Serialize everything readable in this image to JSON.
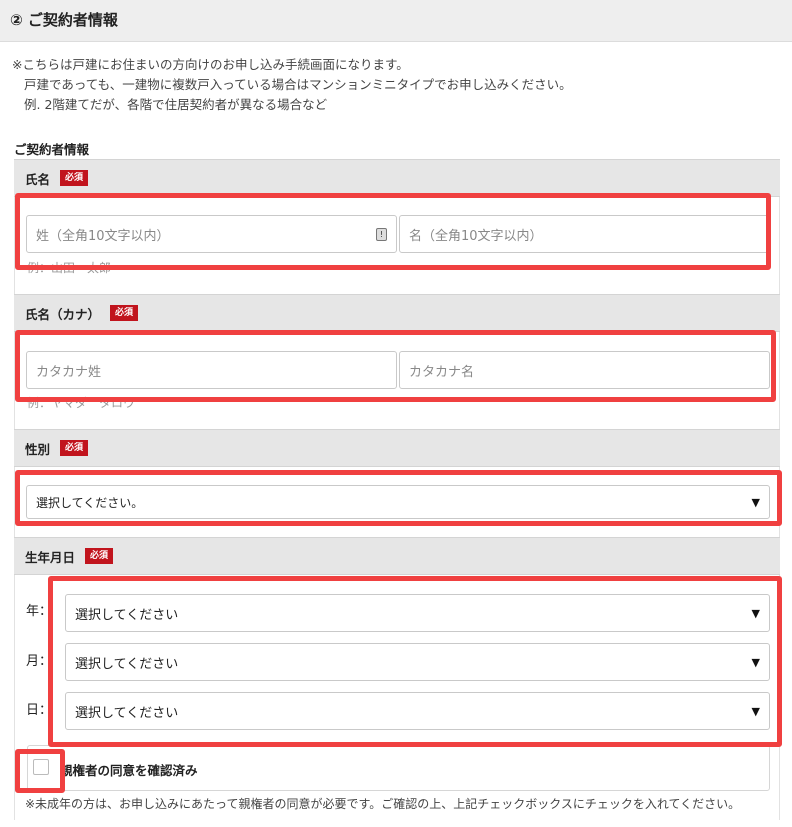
{
  "section": {
    "title": "② ご契約者情報"
  },
  "notice": {
    "line1": "※こちらは戸建にお住まいの方向けのお申し込み手続画面になります。",
    "line2": "戸建であっても、一建物に複数戸入っている場合はマンションミニタイプでお申し込みください。",
    "line3": "例. 2階建てだが、各階で住居契約者が異なる場合など"
  },
  "block_title": "ご契約者情報",
  "required_badge": "必須",
  "name": {
    "label": "氏名",
    "last_placeholder": "姓（全角10文字以内）",
    "first_placeholder": "名（全角10文字以内）",
    "example": "例：山田　太郎"
  },
  "kana": {
    "label": "氏名（カナ）",
    "last_placeholder": "カタカナ姓",
    "first_placeholder": "カタカナ名",
    "example": "例：ヤマダ　タロウ"
  },
  "gender": {
    "label": "性別",
    "selected": "選択してください。"
  },
  "dob": {
    "label": "生年月日",
    "year_label": "年：",
    "month_label": "月：",
    "day_label": "日：",
    "year_selected": "選択してください",
    "month_selected": "選択してください",
    "day_selected": "選択してください"
  },
  "consent": {
    "label": "親権者の同意を確認済み",
    "checked": false,
    "note": "※未成年の方は、お申し込みにあたって親権者の同意が必要です。ご確認の上、上記チェックボックスにチェックを入れてください。"
  },
  "colors": {
    "highlight": "#f04040",
    "required": "#c1141d",
    "header_bg": "#e6e6e6"
  },
  "icons": {
    "caret": "▼"
  }
}
